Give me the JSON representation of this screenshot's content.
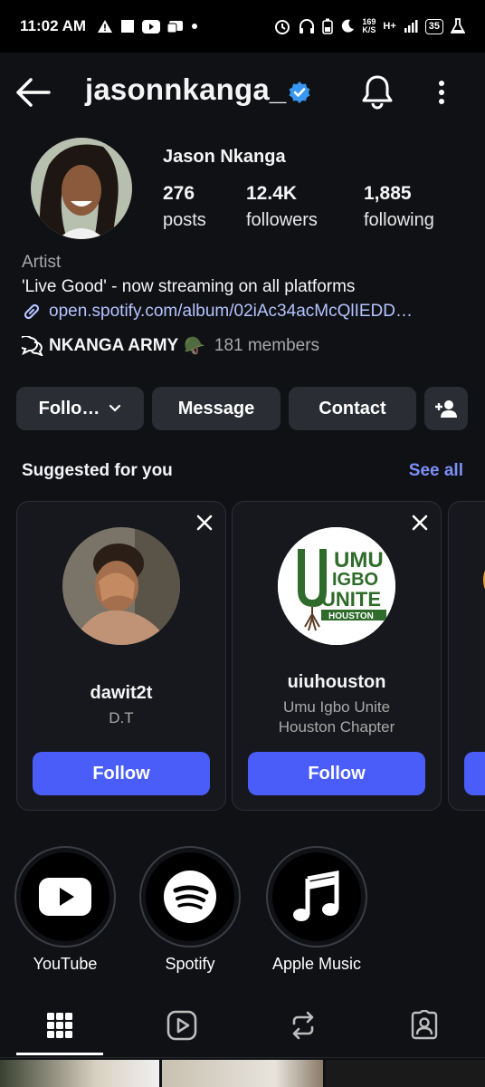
{
  "status_bar": {
    "time": "11:02 AM",
    "speed_value": "169",
    "speed_unit": "K/S",
    "network": "H+",
    "battery": "35"
  },
  "profile": {
    "handle": "jasonnkanga_",
    "full_name": "Jason Nkanga",
    "stats": [
      {
        "value": "276",
        "label": "posts"
      },
      {
        "value": "12.4K",
        "label": "followers"
      },
      {
        "value": "1,885",
        "label": "following"
      }
    ],
    "category": "Artist",
    "bio_line": "'Live Good' - now streaming on all platforms",
    "link": "open.spotify.com/album/02iAc34acMcQlIEDD…",
    "community": {
      "name": "NKANGA ARMY",
      "emoji": "🪖",
      "members": "181 members"
    }
  },
  "actions": {
    "following_label": "Follo…",
    "message_label": "Message",
    "contact_label": "Contact"
  },
  "suggested": {
    "title": "Suggested for you",
    "see_all": "See all",
    "cards": [
      {
        "username": "dawit2t",
        "subtitle": "D.T",
        "follow_label": "Follow"
      },
      {
        "username": "uiuhouston",
        "subtitle_line1": "Umu Igbo Unite",
        "subtitle_line2": "Houston Chapter",
        "follow_label": "Follow",
        "logo_text": [
          "UMU",
          "IGBO",
          "UNITE",
          "HOUSTON"
        ]
      }
    ]
  },
  "highlights": [
    {
      "label": "YouTube"
    },
    {
      "label": "Spotify"
    },
    {
      "label": "Apple Music"
    }
  ],
  "colors": {
    "accent": "#4a5df9",
    "link": "#b5c3ff",
    "verified": "#3897f0",
    "background": "#0f1115"
  }
}
